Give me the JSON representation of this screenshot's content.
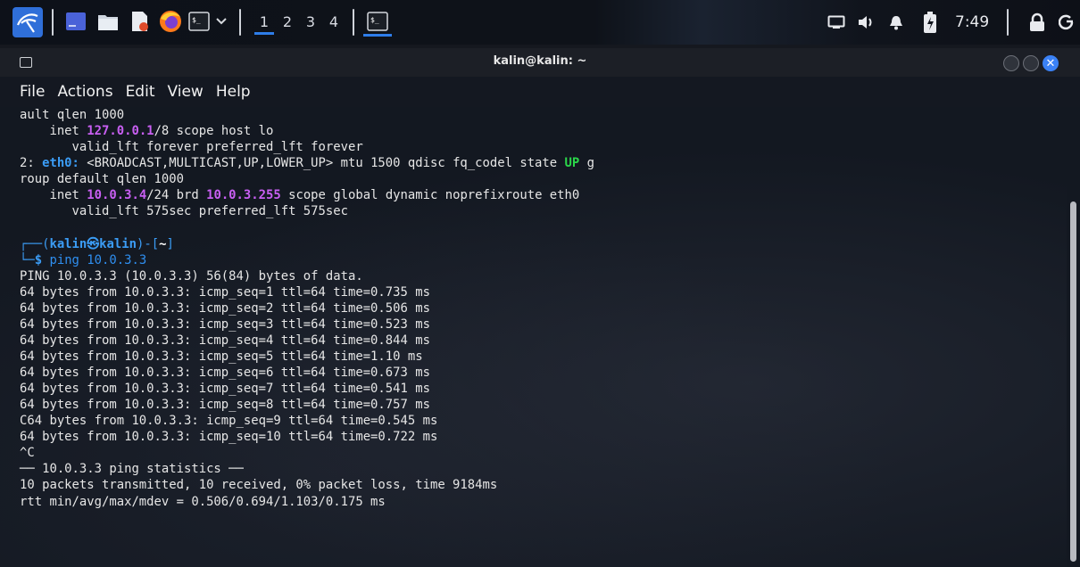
{
  "taskbar": {
    "workspaces": [
      "1",
      "2",
      "3",
      "4"
    ],
    "clock": "7:49",
    "icons": [
      "kali-menu-icon",
      "desktop-icon",
      "files-icon",
      "text-editor-icon",
      "firefox-icon",
      "terminal-icon",
      "dropdown-chevron-icon",
      "terminal-task-icon",
      "screen-icon",
      "volume-icon",
      "notification-bell-icon",
      "battery-icon",
      "lock-icon",
      "power-icon"
    ],
    "accent": "#2e7de9"
  },
  "window": {
    "title": "kalin@kalin: ~",
    "menu": [
      "File",
      "Actions",
      "Edit",
      "View",
      "Help"
    ]
  },
  "terminal": {
    "l01": "ault qlen 1000",
    "l02_pre": "    inet ",
    "l02_ip": "127.0.0.1",
    "l02_post": "/8 scope host lo",
    "l03": "       valid_lft forever preferred_lft forever",
    "l04_num": "2: ",
    "l04_if": "eth0:",
    "l04_mid": " <BROADCAST,MULTICAST,UP,LOWER_UP> mtu 1500 qdisc fq_codel state ",
    "l04_up": "UP",
    "l04_end": " g",
    "l05": "roup default qlen 1000",
    "l06_pre": "    inet ",
    "l06_ip": "10.0.3.4",
    "l06_mid": "/24 brd ",
    "l06_brd": "10.0.3.255",
    "l06_post": " scope global dynamic noprefixroute eth0",
    "l07": "       valid_lft 575sec preferred_lft 575sec",
    "l08": "",
    "prompt_open": "┌──(",
    "prompt_user": "kalin㉿kalin",
    "prompt_mid": ")-[",
    "prompt_dir": "~",
    "prompt_close": "]",
    "prompt2": "└─",
    "prompt_dollar": "$",
    "command": " ping 10.0.3.3",
    "out": [
      "PING 10.0.3.3 (10.0.3.3) 56(84) bytes of data.",
      "64 bytes from 10.0.3.3: icmp_seq=1 ttl=64 time=0.735 ms",
      "64 bytes from 10.0.3.3: icmp_seq=2 ttl=64 time=0.506 ms",
      "64 bytes from 10.0.3.3: icmp_seq=3 ttl=64 time=0.523 ms",
      "64 bytes from 10.0.3.3: icmp_seq=4 ttl=64 time=0.844 ms",
      "64 bytes from 10.0.3.3: icmp_seq=5 ttl=64 time=1.10 ms",
      "64 bytes from 10.0.3.3: icmp_seq=6 ttl=64 time=0.673 ms",
      "64 bytes from 10.0.3.3: icmp_seq=7 ttl=64 time=0.541 ms",
      "64 bytes from 10.0.3.3: icmp_seq=8 ttl=64 time=0.757 ms",
      "C64 bytes from 10.0.3.3: icmp_seq=9 ttl=64 time=0.545 ms",
      "64 bytes from 10.0.3.3: icmp_seq=10 ttl=64 time=0.722 ms",
      "^C",
      "── 10.0.3.3 ping statistics ──",
      "10 packets transmitted, 10 received, 0% packet loss, time 9184ms",
      "rtt min/avg/max/mdev = 0.506/0.694/1.103/0.175 ms"
    ]
  }
}
